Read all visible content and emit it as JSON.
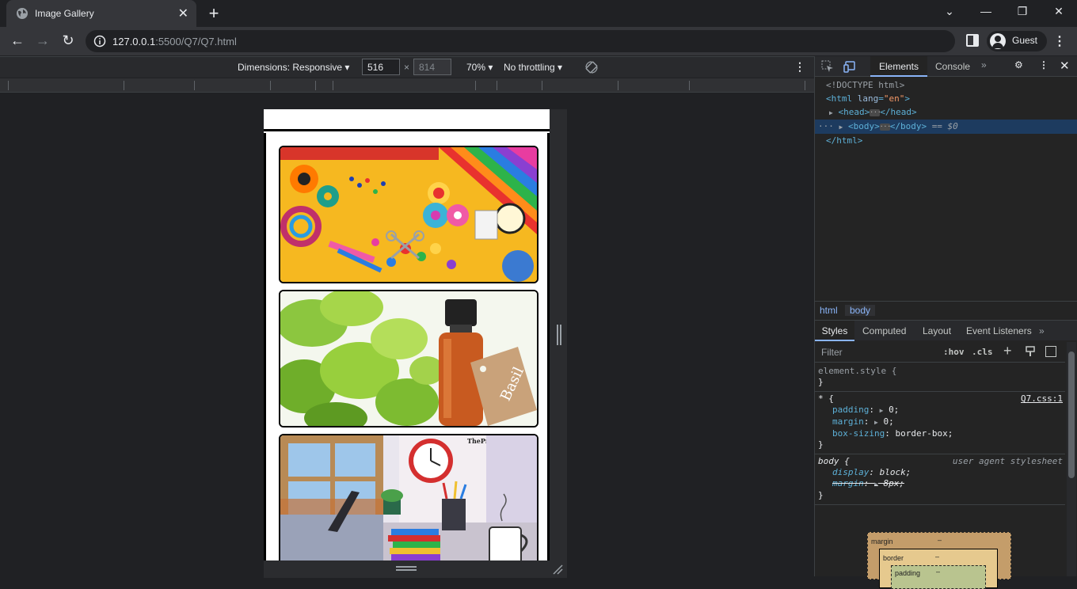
{
  "browser": {
    "tab_title": "Image Gallery",
    "url_host": "127.0.0.1",
    "url_rest": ":5500/Q7/Q7.html",
    "profile_name": "Guest"
  },
  "device_toolbar": {
    "dimensions_label": "Dimensions: Responsive",
    "width_value": "516",
    "times": "×",
    "height_placeholder": "814",
    "zoom": "70%",
    "throttling": "No throttling"
  },
  "gallery": {
    "images": [
      {
        "name": "craft-supplies"
      },
      {
        "name": "basil-oil"
      },
      {
        "name": "workspace-illustration",
        "caption": "ThePrint"
      }
    ]
  },
  "devtools": {
    "tabs": {
      "elements": "Elements",
      "console": "Console",
      "more": "»"
    },
    "dom": {
      "doctype": "<!DOCTYPE html>",
      "html_open_tag": "html",
      "html_attr": "lang",
      "html_attr_val": "\"en\"",
      "head_open": "<head>",
      "head_close": "</head>",
      "body_open": "<body>",
      "body_close": "</body>",
      "body_eq": "== $0",
      "html_close": "</html>"
    },
    "breadcrumbs": [
      "html",
      "body"
    ],
    "style_tabs": [
      "Styles",
      "Computed",
      "Layout",
      "Event Listeners",
      "»"
    ],
    "filter_placeholder": "Filter",
    "hov": ":hov",
    "cls": ".cls",
    "rules": {
      "element_style": "element.style {",
      "close": "}",
      "universal_selector": "* {",
      "universal_source": "Q7.css:1",
      "padding_name": "padding",
      "padding_value": "0;",
      "margin_name": "margin",
      "margin_value": "0;",
      "boxsizing_name": "box-sizing",
      "boxsizing_value": "border-box;",
      "body_selector": "body {",
      "ua_source": "user agent stylesheet",
      "display_name": "display",
      "display_value": "block;",
      "ua_margin_name": "margin",
      "ua_margin_value": "8px;"
    },
    "box_model": {
      "margin": "margin",
      "border": "border",
      "padding": "padding",
      "dash": "–"
    }
  }
}
